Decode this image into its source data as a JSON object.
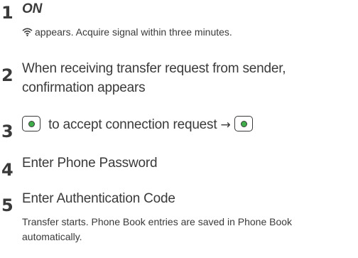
{
  "steps": [
    {
      "number": "1",
      "main": "ON",
      "sub": "appears. Acquire signal within three minutes.",
      "sub_icon": "wireless-signal-icon"
    },
    {
      "number": "2",
      "main_line1": "When receiving transfer request from sender,",
      "main_line2": "confirmation appears"
    },
    {
      "number": "3",
      "main": "to accept connection request",
      "key_icon": "center-key-icon",
      "arrow": "→"
    },
    {
      "number": "4",
      "main": "Enter Phone Password"
    },
    {
      "number": "5",
      "main": "Enter Authentication Code",
      "sub_line1": "Transfer starts. Phone Book entries are saved in Phone Book",
      "sub_line2": "automatically."
    }
  ],
  "colors": {
    "text": "#3a3a3a",
    "key_green": "#3fae4a"
  }
}
